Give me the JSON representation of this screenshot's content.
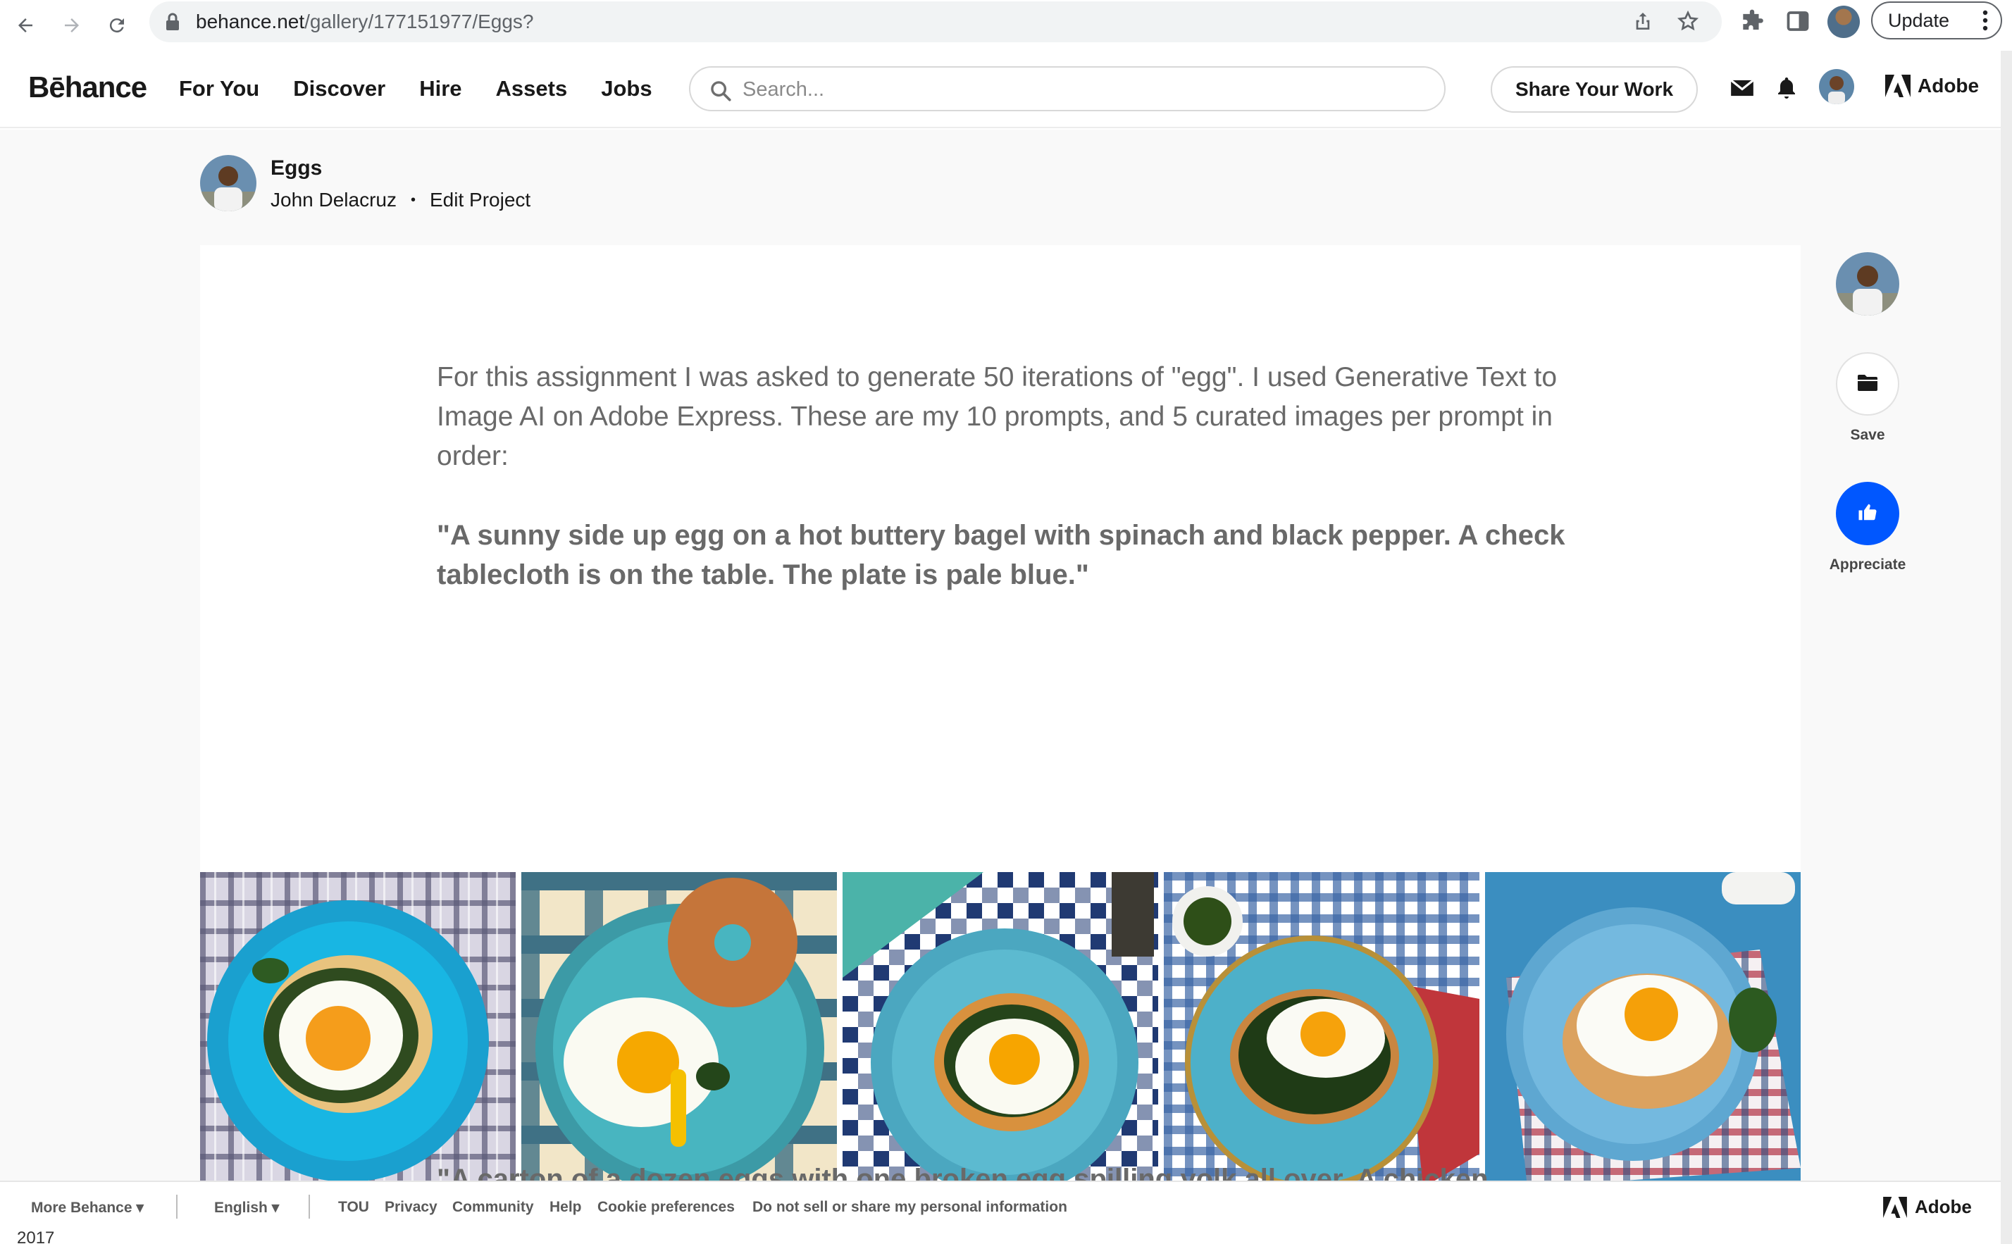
{
  "browser": {
    "url_host": "behance.net",
    "url_path": "/gallery/177151977/Eggs?",
    "update_label": "Update"
  },
  "header": {
    "logo": "Bēhance",
    "nav": [
      "For You",
      "Discover",
      "Hire",
      "Assets",
      "Jobs"
    ],
    "search_placeholder": "Search...",
    "share_label": "Share Your Work",
    "adobe_label": "Adobe"
  },
  "project": {
    "title": "Eggs",
    "owner": "John Delacruz",
    "edit_label": "Edit Project",
    "description": "For this assignment I was asked to generate 50 iterations of \"egg\". I used Generative Text to Image AI on Adobe Express. These are my 10 prompts, and 5 curated images per prompt in order:",
    "prompt1": "\"A sunny side up egg on a hot buttery bagel with spinach and black pepper. A check tablecloth is on the table. The plate is pale blue.\"",
    "prompt2": "\"A carton of a dozen eggs with one broken egg spilling yolk all over. A chicken"
  },
  "rail": {
    "save_label": "Save",
    "appreciate_label": "Appreciate",
    "accent": "#0057ff"
  },
  "footer": {
    "more": "More Behance",
    "language": "English",
    "links": [
      "TOU",
      "Privacy",
      "Community",
      "Help",
      "Cookie preferences",
      "Do not sell or share my personal information"
    ],
    "adobe_label": "Adobe"
  },
  "below_text": "2017"
}
